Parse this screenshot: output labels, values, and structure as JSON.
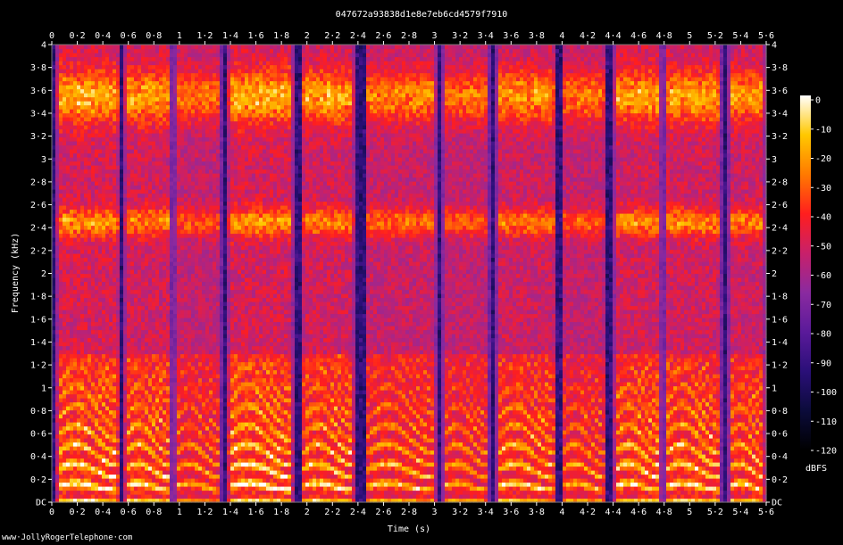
{
  "chart_data": {
    "type": "heatmap",
    "title": "047672a93838d1e8e7eb6cd4579f7910",
    "xlabel": "Time (s)",
    "ylabel": "Frequency (kHz)",
    "xlim": [
      0,
      5.6
    ],
    "ylim": [
      0,
      4
    ],
    "x_ticks": [
      "0",
      "0·2",
      "0·4",
      "0·6",
      "0·8",
      "1",
      "1·2",
      "1·4",
      "1·6",
      "1·8",
      "2",
      "2·2",
      "2·4",
      "2·6",
      "2·8",
      "3",
      "3·2",
      "3·4",
      "3·6",
      "3·8",
      "4",
      "4·2",
      "4·4",
      "4·6",
      "4·8",
      "5",
      "5·2",
      "5·4",
      "5·6"
    ],
    "y_ticks": [
      "DC",
      "0·2",
      "0·4",
      "0·6",
      "0·8",
      "1",
      "1·2",
      "1·4",
      "1·6",
      "1·8",
      "2",
      "2·2",
      "2·4",
      "2·6",
      "2·8",
      "3",
      "3·2",
      "3·4",
      "3·6",
      "3·8",
      "4"
    ],
    "colorbar": {
      "label": "dBFS",
      "range": [
        -120,
        0
      ],
      "ticks": [
        "0",
        "-10",
        "-20",
        "-30",
        "-40",
        "-50",
        "-60",
        "-70",
        "-80",
        "-90",
        "-100",
        "-110",
        "-120"
      ]
    },
    "segments": [
      {
        "start": 0.03,
        "end": 0.54,
        "strength": 1.0
      },
      {
        "start": 0.56,
        "end": 0.94,
        "strength": 0.95
      },
      {
        "start": 0.96,
        "end": 1.33,
        "strength": 0.8
      },
      {
        "start": 1.37,
        "end": 1.9,
        "strength": 1.0
      },
      {
        "start": 1.95,
        "end": 2.38,
        "strength": 0.95
      },
      {
        "start": 2.45,
        "end": 3.02,
        "strength": 0.85
      },
      {
        "start": 3.06,
        "end": 3.43,
        "strength": 0.8
      },
      {
        "start": 3.48,
        "end": 3.96,
        "strength": 0.9
      },
      {
        "start": 3.99,
        "end": 4.35,
        "strength": 0.8
      },
      {
        "start": 4.4,
        "end": 4.78,
        "strength": 0.95
      },
      {
        "start": 4.8,
        "end": 5.25,
        "strength": 0.95
      },
      {
        "start": 5.3,
        "end": 5.6,
        "strength": 0.9
      }
    ],
    "colors": {
      "background": "#000000",
      "scale": [
        "#000000",
        "#0b0b3a",
        "#2a0f78",
        "#5a1a9a",
        "#8a2aa0",
        "#c8206a",
        "#ff1e1e",
        "#ff7a00",
        "#ffc800",
        "#ffffff"
      ]
    }
  },
  "footer": {
    "credit": "www·JollyRogerTelephone·com"
  }
}
